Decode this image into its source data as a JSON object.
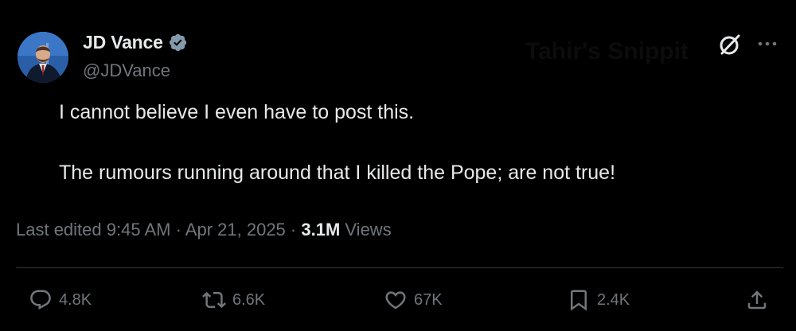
{
  "author": {
    "name": "JD Vance",
    "handle": "@JDVance",
    "verified": true,
    "avatar": "avatar-photo"
  },
  "watermark": "Tahir's Snippit",
  "tweet": {
    "lines": [
      "I cannot believe I even have to post this.",
      "The rumours running around that I killed the Pope; are not true!"
    ]
  },
  "meta": {
    "edited_label": "Last edited 9:45 AM · Apr 21, 2025 ·",
    "views_count": "3.1M",
    "views_label": "Views"
  },
  "actions": {
    "reply": {
      "icon": "reply-icon",
      "count": "4.8K"
    },
    "repost": {
      "icon": "repost-icon",
      "count": "6.6K"
    },
    "like": {
      "icon": "heart-icon",
      "count": "67K"
    },
    "bookmark": {
      "icon": "bookmark-icon",
      "count": "2.4K"
    },
    "share": {
      "icon": "share-icon"
    }
  },
  "colors": {
    "background": "#000000",
    "text": "#e7e9ea",
    "secondary": "#71767b",
    "verified": "#829aab",
    "divider": "#2f3336"
  }
}
